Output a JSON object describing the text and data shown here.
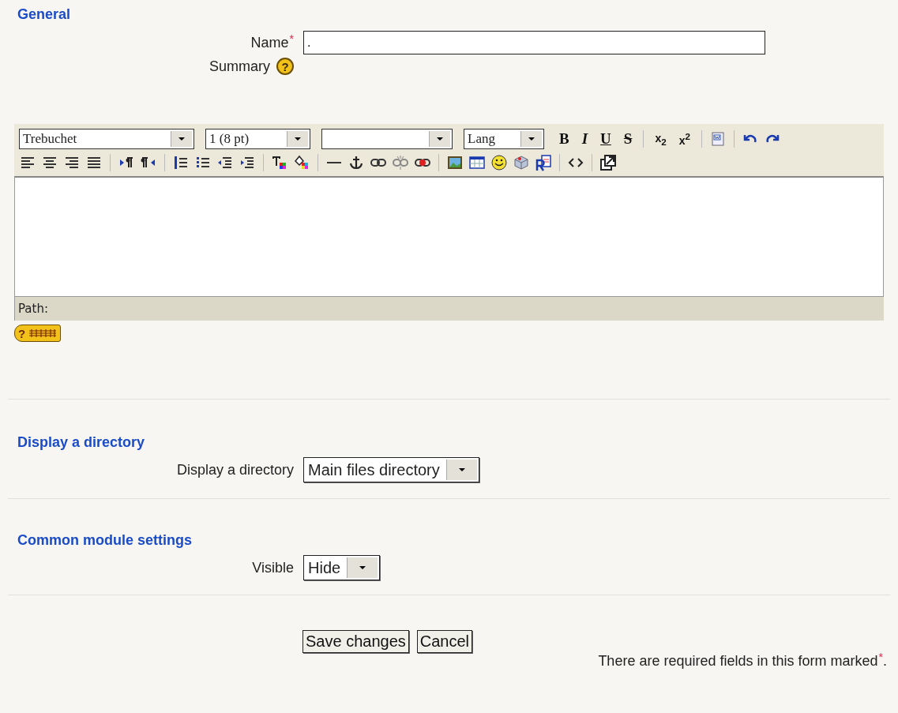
{
  "general": {
    "heading": "General",
    "name": {
      "label": "Name",
      "required_mark": "*",
      "value": "."
    },
    "summary": {
      "label": "Summary",
      "help": "?"
    },
    "editor": {
      "selects": [
        {
          "value": "Trebuchet"
        },
        {
          "value": "1 (8 pt)"
        },
        {
          "value": "Lang"
        }
      ],
      "format_buttons": [
        "B",
        "I",
        "U",
        "S",
        "x$_{2}$",
        "x$^{2}$"
      ],
      "path_label": "Path:",
      "help_badge": "?"
    }
  },
  "directory": {
    "heading": "Display a directory",
    "label": "Display a directory",
    "value": "Main files directory"
  },
  "module": {
    "heading": "Common module settings",
    "label": "Visible",
    "value": "Hide"
  },
  "buttons": [
    "Save changes",
    "Cancel"
  ],
  "required_note": {
    "text": "There are required fields in this form marked",
    "mark": "*",
    "end": "."
  }
}
